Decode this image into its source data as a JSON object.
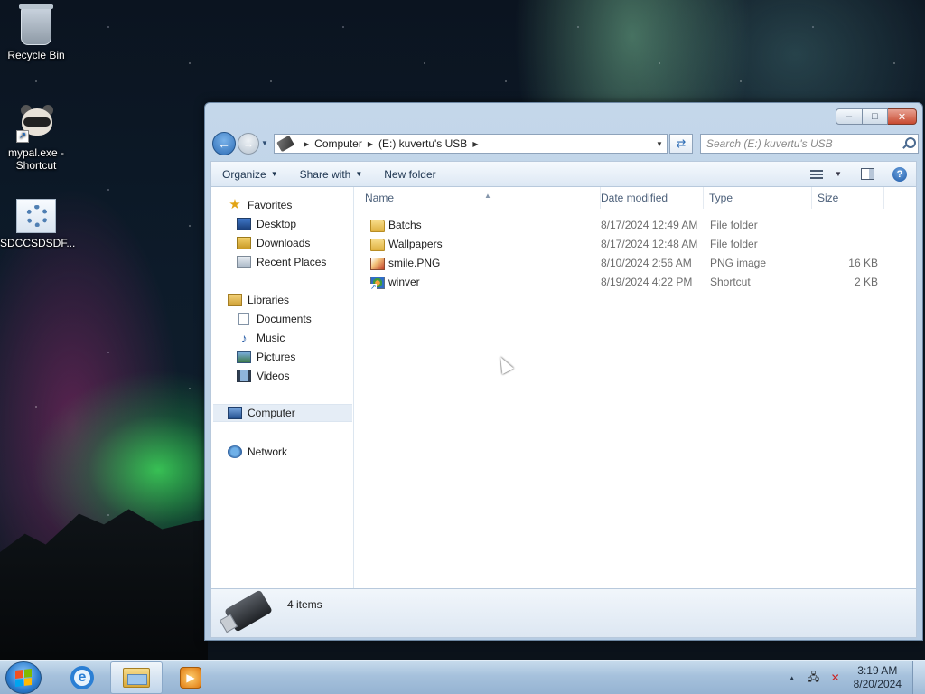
{
  "desktop": {
    "icons": [
      {
        "label": "Recycle Bin",
        "icon": "recycle-bin-icon"
      },
      {
        "label": "mypal.exe - Shortcut",
        "icon": "raccoon-shortcut-icon"
      },
      {
        "label": "SDCCSDSDF...",
        "icon": "settings-gear-icon"
      }
    ]
  },
  "window": {
    "caption_buttons": {
      "minimize": "‒",
      "maximize": "□",
      "close": "✕"
    },
    "address": {
      "crumbs": [
        "Computer",
        "(E:) kuvertu's USB"
      ]
    },
    "search": {
      "placeholder": "Search (E:) kuvertu's USB"
    },
    "toolbar": {
      "organize": "Organize",
      "share_with": "Share with",
      "new_folder": "New folder"
    },
    "navigation": {
      "favorites": {
        "label": "Favorites",
        "items": [
          "Desktop",
          "Downloads",
          "Recent Places"
        ]
      },
      "libraries": {
        "label": "Libraries",
        "items": [
          "Documents",
          "Music",
          "Pictures",
          "Videos"
        ]
      },
      "computer": "Computer",
      "network": "Network"
    },
    "columns": [
      "Name",
      "Date modified",
      "Type",
      "Size"
    ],
    "files": [
      {
        "name": "Batchs",
        "date_modified": "8/17/2024 12:49 AM",
        "type": "File folder",
        "size": "",
        "icon": "folder-icon"
      },
      {
        "name": "Wallpapers",
        "date_modified": "8/17/2024 12:48 AM",
        "type": "File folder",
        "size": "",
        "icon": "folder-icon"
      },
      {
        "name": "smile.PNG",
        "date_modified": "8/10/2024 2:56 AM",
        "type": "PNG image",
        "size": "16 KB",
        "icon": "png-image-icon"
      },
      {
        "name": "winver",
        "date_modified": "8/19/2024 4:22 PM",
        "type": "Shortcut",
        "size": "2 KB",
        "icon": "shortcut-icon"
      }
    ],
    "details": {
      "count": "4 items"
    }
  },
  "taskbar": {
    "pinned": [
      "internet-explorer-icon",
      "windows-explorer-icon",
      "media-player-icon"
    ],
    "active": "windows-explorer-icon",
    "clock": {
      "time": "3:19 AM",
      "date": "8/20/2024"
    }
  }
}
